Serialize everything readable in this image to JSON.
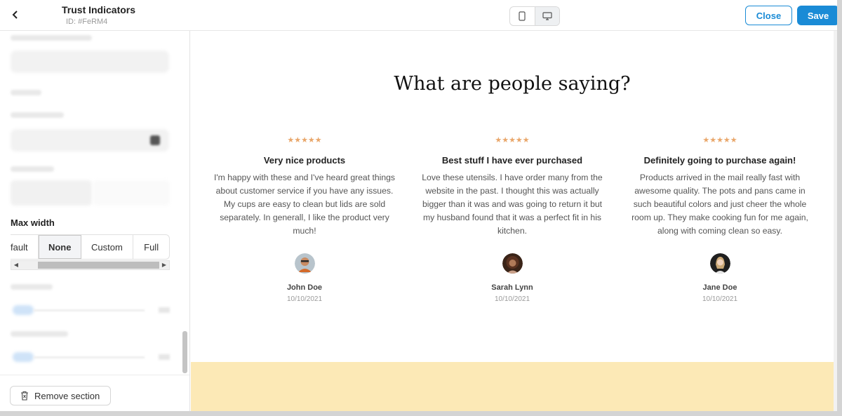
{
  "topbar": {
    "title": "Trust Indicators",
    "id_label": "ID: #FeRM4",
    "close_label": "Close",
    "save_label": "Save",
    "devices": [
      "mobile-icon",
      "desktop-icon"
    ],
    "active_device": "desktop"
  },
  "sidebar": {
    "max_width_label": "Max width",
    "max_width_options": [
      "fault",
      "None",
      "Custom",
      "Full"
    ],
    "max_width_selected": "None",
    "remove_label": "Remove section"
  },
  "preview": {
    "heading": "What are people saying?",
    "testimonials": [
      {
        "stars": "★★★★★",
        "title": "Very nice products",
        "body": "I'm happy with these and I've heard great things about  customer service if you have any issues. My cups are easy to clean but lids are sold separately. In generall, I like the product very much!",
        "name": "John Doe",
        "date": "10/10/2021"
      },
      {
        "stars": "★★★★★",
        "title": "Best stuff I have ever purchased",
        "body": "Love these utensils. I have order many from the website in the past. I thought this was actually bigger than it was and was going to return it but my husband found that it was a perfect fit in his kitchen.",
        "name": "Sarah Lynn",
        "date": "10/10/2021"
      },
      {
        "stars": "★★★★★",
        "title": "Definitely going to purchase again!",
        "body": "Products arrived in the mail really fast with awesome quality. The pots and pans came in such beautiful colors and just cheer the whole room up. They make cooking fun for me again, along with coming clean so easy.",
        "name": "Jane Doe",
        "date": "10/10/2021"
      }
    ]
  },
  "colors": {
    "accent": "#1a8bd6",
    "stars": "#e9a76b",
    "band": "#fce9b6"
  }
}
